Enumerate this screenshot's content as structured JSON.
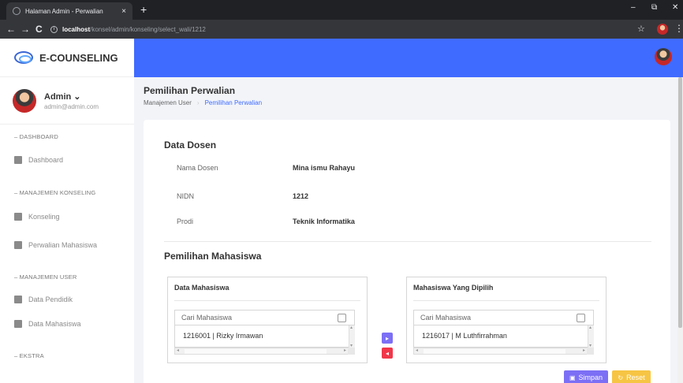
{
  "browser": {
    "tab_title": "Halaman Admin - Perwalian",
    "tab_close": "×",
    "new_tab": "+",
    "url_host": "localhost",
    "url_path": "/konsel/admin/konseling/select_wali/1212",
    "minimize": "–",
    "restore": "⧉",
    "close": "✕",
    "back": "←",
    "forward": "→",
    "reload": "C",
    "info": "i",
    "bookmark": "☆",
    "menu": "⋮"
  },
  "brand": {
    "name": "E-COUNSELING"
  },
  "user": {
    "name": "Admin ⌄",
    "email": "admin@admin.com"
  },
  "sidebar": {
    "head_dashboard": "– DASHBOARD",
    "dashboard": "Dashboard",
    "head_konseling": "– MANAJEMEN KONSELING",
    "konseling": "Konseling",
    "perwalian": "Perwalian Mahasiswa",
    "head_user": "– MANAJEMEN USER",
    "pendidik": "Data Pendidik",
    "mahasiswa": "Data Mahasiswa",
    "head_ekstra": "– EKSTRA"
  },
  "page": {
    "title": "Pemilihan Perwalian",
    "breadcrumb_root": "Manajemen User",
    "breadcrumb_sep": "›",
    "breadcrumb_current": "Pemilihan Perwalian"
  },
  "dosen": {
    "title": "Data Dosen",
    "nama_label": "Nama Dosen",
    "nama_value": "Mina ismu Rahayu",
    "nidn_label": "NIDN",
    "nidn_value": "1212",
    "prodi_label": "Prodi",
    "prodi_value": "Teknik Informatika"
  },
  "pemilihan": {
    "title": "Pemilihan Mahasiswa",
    "left_box": {
      "title": "Data Mahasiswa",
      "search_placeholder": "Cari Mahasiswa",
      "items": [
        "1216001 | Rizky Irmawan"
      ]
    },
    "right_box": {
      "title": "Mahasiswa Yang Dipilih",
      "search_placeholder": "Cari Mahasiswa",
      "items": [
        "1216017 | M Luthfirrahman"
      ]
    },
    "move_right": "▸",
    "move_left": "◂",
    "save_label": "Simpan",
    "reset_label": "Reset"
  },
  "colors": {
    "primary": "#3f6bff",
    "save": "#7c6ff5",
    "reset": "#f7c544",
    "remove": "#f0374a"
  }
}
